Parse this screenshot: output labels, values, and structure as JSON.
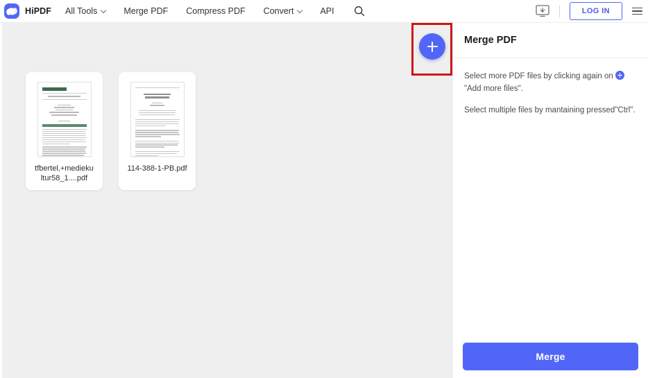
{
  "nav": {
    "brand": "HiPDF",
    "logo_icon": "hipdf-logo-icon",
    "links": [
      {
        "label": "All Tools",
        "has_caret": true
      },
      {
        "label": "Merge PDF",
        "has_caret": false
      },
      {
        "label": "Compress PDF",
        "has_caret": false
      },
      {
        "label": "Convert",
        "has_caret": true
      },
      {
        "label": "API",
        "has_caret": false
      }
    ],
    "search_icon": "search-icon",
    "desktop_download_icon": "desktop-download-icon",
    "login_label": "LOG IN",
    "menu_icon": "hamburger-menu-icon",
    "accent_color": "#5166F7"
  },
  "workspace": {
    "files": [
      {
        "name": "tfbertel,+medieku ltur58_1....pdf"
      },
      {
        "name": "114-388-1-PB.pdf"
      }
    ],
    "background_color": "#EFEFEF"
  },
  "add_button": {
    "icon": "plus-icon",
    "highlight_color": "#CC1717",
    "fill_color": "#5166F7"
  },
  "panel": {
    "title": "Merge PDF",
    "paragraph_1_before": "Select more PDF files by clicking again on",
    "paragraph_1_after": "\"Add more files\".",
    "inline_icon": "plus-badge-icon",
    "paragraph_2": "Select multiple files by mantaining pressed\"Ctrl\".",
    "merge_label": "Merge",
    "merge_color": "#5166F7"
  }
}
